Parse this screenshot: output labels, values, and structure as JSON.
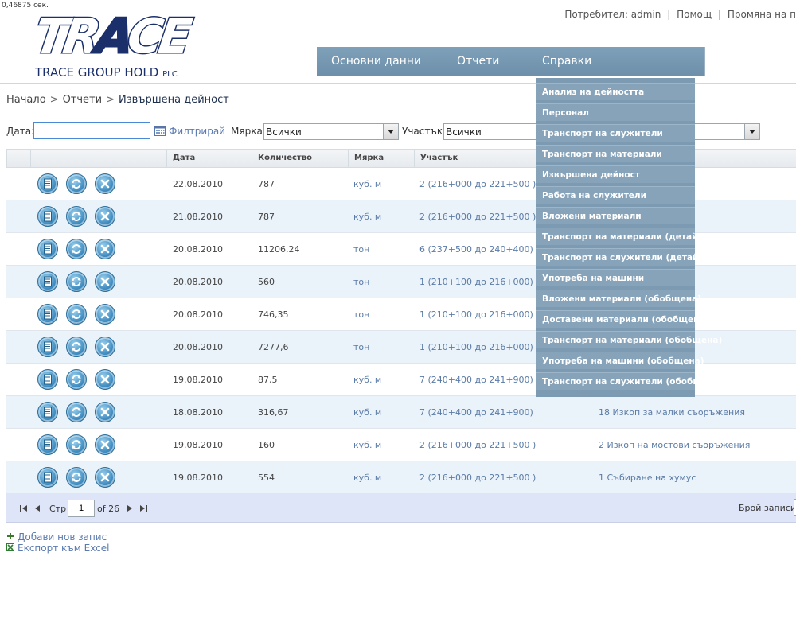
{
  "timer": "0,46875 сек.",
  "logo": {
    "word_tr": "TR",
    "word_a": "A",
    "word_ce": "CE",
    "sub_main": "TRACE GROUP HOLD",
    "sub_suffix": "PLC"
  },
  "userbar": {
    "user_label": "Потребител:",
    "user_name": "admin",
    "sep": "|",
    "help": "Помощ",
    "change": "Промяна на п"
  },
  "nav": {
    "items": [
      "Основни данни",
      "Отчети",
      "Справки"
    ]
  },
  "breadcrumb": {
    "home": "Начало",
    "sep": ">",
    "reports": "Отчети",
    "current": "Извършена дейност"
  },
  "filter": {
    "date_label": "Дата:",
    "date_value": "",
    "filter_link": "Филтрирай",
    "unit_label": "Мярка:",
    "unit_value": "Всички",
    "section_label": "Участък:",
    "section_value": "Всички"
  },
  "grid": {
    "headers": [
      "Дата",
      "Количество",
      "Мярка",
      "Участък"
    ],
    "rows": [
      {
        "date": "22.08.2010",
        "qty": "787",
        "unit": "куб. м",
        "section": "2 (216+000 до 221+500 )",
        "activity": ""
      },
      {
        "date": "21.08.2010",
        "qty": "787",
        "unit": "куб. м",
        "section": "2 (216+000 до 221+500 )",
        "activity": ""
      },
      {
        "date": "20.08.2010",
        "qty": "11206,24",
        "unit": "тон",
        "section": "6 (237+500 до 240+400)",
        "activity": ""
      },
      {
        "date": "20.08.2010",
        "qty": "560",
        "unit": "тон",
        "section": "1 (210+100 до 216+000)",
        "activity": "лки съоръжения"
      },
      {
        "date": "20.08.2010",
        "qty": "746,35",
        "unit": "тон",
        "section": "1 (210+100 до 216+000)",
        "activity": "дове дейности"
      },
      {
        "date": "20.08.2010",
        "qty": "7277,6",
        "unit": "тон",
        "section": "1 (210+100 до 216+000)",
        "activity": ""
      },
      {
        "date": "19.08.2010",
        "qty": "87,5",
        "unit": "куб. м",
        "section": "7 (240+400 до 241+900)",
        "activity": "ръжения"
      },
      {
        "date": "18.08.2010",
        "qty": "316,67",
        "unit": "куб. м",
        "section": "7 (240+400 до 241+900)",
        "activity": "18 Изкоп за малки съоръжения"
      },
      {
        "date": "19.08.2010",
        "qty": "160",
        "unit": "куб. м",
        "section": "2 (216+000 до 221+500 )",
        "activity": "2 Изкоп на мостови съоръжения"
      },
      {
        "date": "19.08.2010",
        "qty": "554",
        "unit": "куб. м",
        "section": "2 (216+000 до 221+500 )",
        "activity": "1 Събиране на хумус"
      }
    ],
    "pager": {
      "page_label": "Стр",
      "page_value": "1",
      "of_label": "of 26",
      "records_label": "Брой записи:"
    }
  },
  "links": {
    "add": "Добави нов запис",
    "export": "Експорт към Excel"
  },
  "dropdown": {
    "items": [
      "Анализ на дейността",
      "Персонал",
      "Транспорт на служители",
      "Транспорт на материали",
      "Извършена дейност",
      "Работа на служители",
      "Вложени материали",
      "Транспорт на материали (детайли)",
      "Транспорт на служители (детайли)",
      "Употреба на машини",
      "Вложени материали (обобщена)",
      "Доставени материали (обобщена)",
      "Транспорт на материали (обобщена)",
      "Употреба на машини (обобщена)",
      "Транспорт на служители (обобщена)"
    ]
  },
  "colors": {
    "nav_bg": "#7fa0b9",
    "logo_blue": "#1b2f6b",
    "link_blue": "#5b7bb0",
    "row_alt": "#eaf2fa",
    "pager_bg": "#dfe5f8"
  },
  "icons": [
    "details-icon",
    "refresh-icon",
    "delete-icon",
    "calendar-icon",
    "plus-icon",
    "excel-icon",
    "first-page-icon",
    "prev-page-icon",
    "next-page-icon",
    "last-page-icon"
  ]
}
